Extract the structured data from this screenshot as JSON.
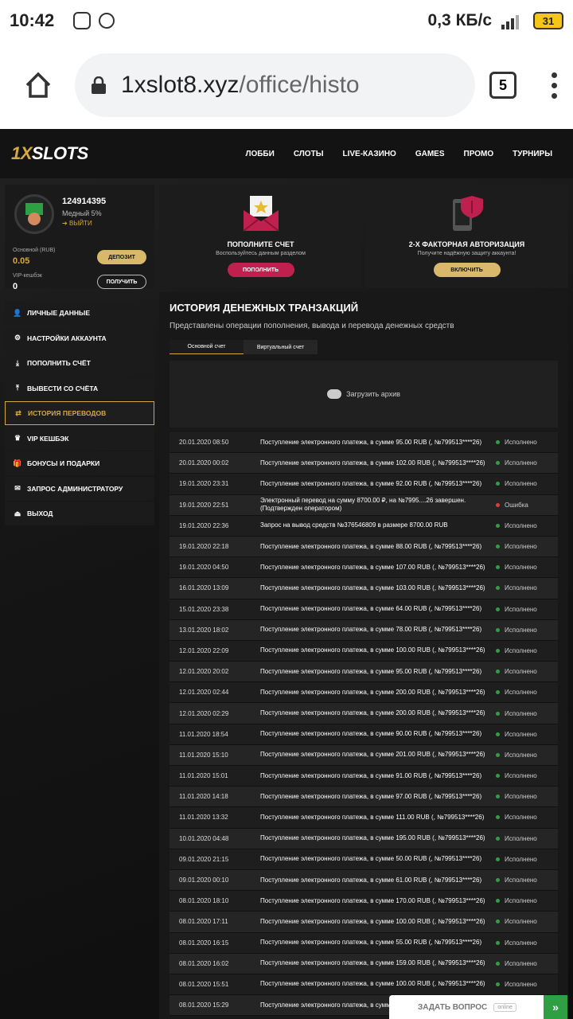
{
  "statusbar": {
    "time": "10:42",
    "speed": "0,3 КБ/с",
    "network": "4G",
    "battery": "31"
  },
  "browser": {
    "url_host": "1xslot8.xyz",
    "url_path": "/office/histo",
    "tab_count": "5"
  },
  "site": {
    "logo": {
      "a": "1X",
      "b": "SLOTS"
    },
    "nav": [
      "ЛОББИ",
      "СЛОТЫ",
      "LIVE-КАЗИНО",
      "GAMES",
      "ПРОМО",
      "ТУРНИРЫ"
    ],
    "profile": {
      "uid": "124914395",
      "rank": "Медный 5%",
      "logout": "ВЫЙТИ",
      "balance_label": "Основной (RUB)",
      "balance_value": "0.05",
      "vip_label": "VIP-кешбэк",
      "vip_value": "0",
      "deposit_btn": "ДЕПОЗИТ",
      "get_btn": "ПОЛУЧИТЬ"
    },
    "menu": [
      {
        "label": "ЛИЧНЫЕ ДАННЫЕ",
        "icon": "user-plus-icon"
      },
      {
        "label": "НАСТРОЙКИ АККАУНТА",
        "icon": "cogs-icon"
      },
      {
        "label": "ПОПОЛНИТЬ СЧЁТ",
        "icon": "download-icon"
      },
      {
        "label": "ВЫВЕСТИ СО СЧЁТА",
        "icon": "upload-icon"
      },
      {
        "label": "ИСТОРИЯ ПЕРЕВОДОВ",
        "icon": "transfer-icon"
      },
      {
        "label": "VIP КЕШБЭК",
        "icon": "crown-icon"
      },
      {
        "label": "БОНУСЫ И ПОДАРКИ",
        "icon": "gift-icon"
      },
      {
        "label": "ЗАПРОС АДМИНИСТРАТОРУ",
        "icon": "envelope-icon"
      },
      {
        "label": "ВЫХОД",
        "icon": "sign-out-icon"
      }
    ],
    "promo1": {
      "title": "ПОПОЛНИТЕ СЧЕТ",
      "sub": "Воспользуйтесь данным разделом",
      "btn": "ПОПОЛНИТЬ"
    },
    "promo2": {
      "title": "2-Х ФАКТОРНАЯ АВТОРИЗАЦИЯ",
      "sub": "Получите надёжную защиту аккаунта!",
      "btn": "ВКЛЮЧИТЬ"
    },
    "history": {
      "title": "ИСТОРИЯ ДЕНЕЖНЫХ ТРАНЗАКЦИЙ",
      "subtitle": "Представлены операции пополнения, вывода и перевода денежных средств",
      "tabs": [
        "Основной счет",
        "Виртуальный счет"
      ],
      "archive": "Загрузить архив",
      "rows": [
        {
          "date": "20.01.2020 08:50",
          "text": "Поступление электронного платежа, в сумме 95.00 RUB (, №799513****26)",
          "status": "Исполнено",
          "ok": true
        },
        {
          "date": "20.01.2020 00:02",
          "text": "Поступление электронного платежа, в сумме 102.00 RUB (, №799513****26)",
          "status": "Исполнено",
          "ok": true
        },
        {
          "date": "19.01.2020 23:31",
          "text": "Поступление электронного платежа, в сумме 92.00 RUB (, №799513****26)",
          "status": "Исполнено",
          "ok": true
        },
        {
          "date": "19.01.2020 22:51",
          "text": "Электронный перевод на сумму 8700.00 ₽, на №7995....26 завершен. (Подтвержден оператором)",
          "status": "Ошибка",
          "ok": false
        },
        {
          "date": "19.01.2020 22:36",
          "text": "Запрос на вывод средств №376546809 в размере 8700.00 RUB",
          "status": "Исполнено",
          "ok": true
        },
        {
          "date": "19.01.2020 22:18",
          "text": "Поступление электронного платежа, в сумме 88.00 RUB (, №799513****26)",
          "status": "Исполнено",
          "ok": true
        },
        {
          "date": "19.01.2020 04:50",
          "text": "Поступление электронного платежа, в сумме 107.00 RUB (, №799513****26)",
          "status": "Исполнено",
          "ok": true
        },
        {
          "date": "16.01.2020 13:09",
          "text": "Поступление электронного платежа, в сумме 103.00 RUB (, №799513****26)",
          "status": "Исполнено",
          "ok": true
        },
        {
          "date": "15.01.2020 23:38",
          "text": "Поступление электронного платежа, в сумме 64.00 RUB (, №799513****26)",
          "status": "Исполнено",
          "ok": true
        },
        {
          "date": "13.01.2020 18:02",
          "text": "Поступление электронного платежа, в сумме 78.00 RUB (, №799513****26)",
          "status": "Исполнено",
          "ok": true
        },
        {
          "date": "12.01.2020 22:09",
          "text": "Поступление электронного платежа, в сумме 100.00 RUB (, №799513****26)",
          "status": "Исполнено",
          "ok": true
        },
        {
          "date": "12.01.2020 20:02",
          "text": "Поступление электронного платежа, в сумме 95.00 RUB (, №799513****26)",
          "status": "Исполнено",
          "ok": true
        },
        {
          "date": "12.01.2020 02:44",
          "text": "Поступление электронного платежа, в сумме 200.00 RUB (, №799513****26)",
          "status": "Исполнено",
          "ok": true
        },
        {
          "date": "12.01.2020 02:29",
          "text": "Поступление электронного платежа, в сумме 200.00 RUB (, №799513****26)",
          "status": "Исполнено",
          "ok": true
        },
        {
          "date": "11.01.2020 18:54",
          "text": "Поступление электронного платежа, в сумме 90.00 RUB (, №799513****26)",
          "status": "Исполнено",
          "ok": true
        },
        {
          "date": "11.01.2020 15:10",
          "text": "Поступление электронного платежа, в сумме 201.00 RUB (, №799513****26)",
          "status": "Исполнено",
          "ok": true
        },
        {
          "date": "11.01.2020 15:01",
          "text": "Поступление электронного платежа, в сумме 91.00 RUB (, №799513****26)",
          "status": "Исполнено",
          "ok": true
        },
        {
          "date": "11.01.2020 14:18",
          "text": "Поступление электронного платежа, в сумме 97.00 RUB (, №799513****26)",
          "status": "Исполнено",
          "ok": true
        },
        {
          "date": "11.01.2020 13:32",
          "text": "Поступление электронного платежа, в сумме 111.00 RUB (, №799513****26)",
          "status": "Исполнено",
          "ok": true
        },
        {
          "date": "10.01.2020 04:48",
          "text": "Поступление электронного платежа, в сумме 195.00 RUB (, №799513****26)",
          "status": "Исполнено",
          "ok": true
        },
        {
          "date": "09.01.2020 21:15",
          "text": "Поступление электронного платежа, в сумме 50.00 RUB (, №799513****26)",
          "status": "Исполнено",
          "ok": true
        },
        {
          "date": "09.01.2020 00:10",
          "text": "Поступление электронного платежа, в сумме 61.00 RUB (, №799513****26)",
          "status": "Исполнено",
          "ok": true
        },
        {
          "date": "08.01.2020 18:10",
          "text": "Поступление электронного платежа, в сумме 170.00 RUB (, №799513****26)",
          "status": "Исполнено",
          "ok": true
        },
        {
          "date": "08.01.2020 17:11",
          "text": "Поступление электронного платежа, в сумме 100.00 RUB (, №799513****26)",
          "status": "Исполнено",
          "ok": true
        },
        {
          "date": "08.01.2020 16:15",
          "text": "Поступление электронного платежа, в сумме 55.00 RUB (, №799513****26)",
          "status": "Исполнено",
          "ok": true
        },
        {
          "date": "08.01.2020 16:02",
          "text": "Поступление электронного платежа, в сумме 159.00 RUB (, №799513****26)",
          "status": "Исполнено",
          "ok": true
        },
        {
          "date": "08.01.2020 15:51",
          "text": "Поступление электронного платежа, в сумме 100.00 RUB (, №799513****26)",
          "status": "Исполнено",
          "ok": true
        },
        {
          "date": "08.01.2020 15:29",
          "text": "Поступление электронного платежа, в сумме",
          "status": "",
          "ok": true
        }
      ]
    },
    "chat": {
      "label": "ЗАДАТЬ ВОПРОС",
      "status": "online"
    }
  }
}
